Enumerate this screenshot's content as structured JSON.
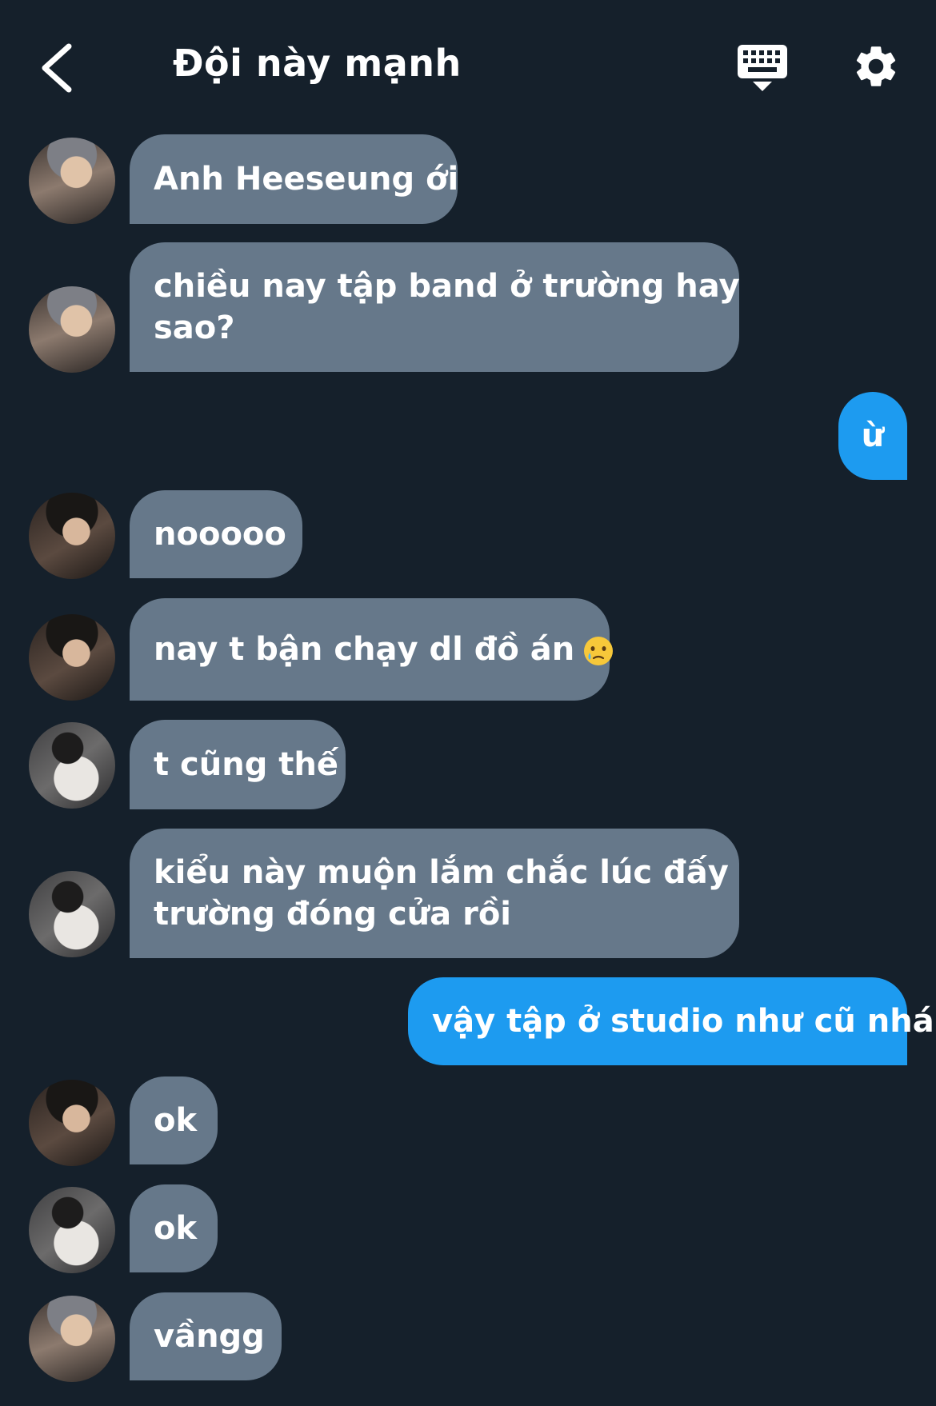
{
  "header": {
    "title": "Đội này mạnh",
    "back_icon": "chevron-left-icon",
    "keyboard_icon": "keyboard-icon",
    "settings_icon": "gear-icon"
  },
  "messages": [
    {
      "direction": "in",
      "sender": "a1",
      "lines": [
        "Anh Heeseung ới"
      ]
    },
    {
      "direction": "in",
      "sender": "a1",
      "lines": [
        "chiều nay tập band ở trường hay",
        "sao?"
      ]
    },
    {
      "direction": "out",
      "lines": [
        "ừ"
      ]
    },
    {
      "direction": "in",
      "sender": "a2",
      "lines": [
        "nooooo"
      ]
    },
    {
      "direction": "in",
      "sender": "a2",
      "lines": [
        "nay t bận chạy dl đồ án"
      ],
      "emoji": "crying-face-emoji"
    },
    {
      "direction": "in",
      "sender": "a3",
      "lines": [
        "t cũng thế"
      ]
    },
    {
      "direction": "in",
      "sender": "a3",
      "lines": [
        "kiểu này muộn lắm chắc lúc đấy",
        "trường đóng cửa rồi"
      ]
    },
    {
      "direction": "out",
      "lines": [
        "vậy tập ở studio như cũ nhá"
      ]
    },
    {
      "direction": "in",
      "sender": "a2",
      "lines": [
        "ok"
      ]
    },
    {
      "direction": "in",
      "sender": "a3",
      "lines": [
        "ok"
      ]
    },
    {
      "direction": "in",
      "sender": "a1",
      "lines": [
        "vầngg"
      ]
    }
  ],
  "colors": {
    "background": "#15202b",
    "incoming_bubble": "#66788a",
    "outgoing_bubble": "#1d9bf0"
  }
}
